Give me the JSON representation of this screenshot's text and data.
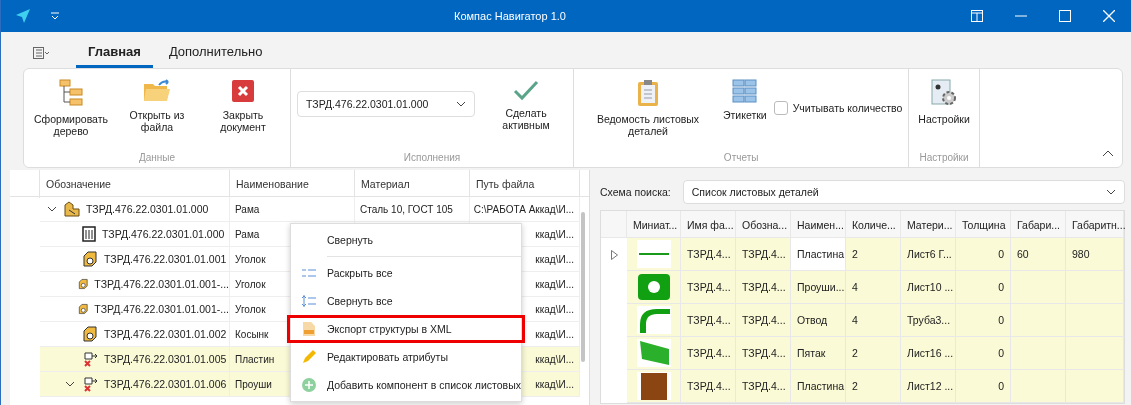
{
  "window": {
    "title": "Компас Навигатор 1.0"
  },
  "tabs": [
    {
      "label": "Главная",
      "selected": true
    },
    {
      "label": "Дополнительно",
      "selected": false
    }
  ],
  "ribbon": {
    "groups": [
      {
        "label": "Данные",
        "buttons": [
          "Сформировать дерево",
          "Открыть из файла",
          "Закрыть документ"
        ]
      },
      {
        "label": "Исполнения",
        "dropdown": "ТЗРД.476.22.0301.01.000",
        "buttons": [
          "Сделать активным"
        ]
      },
      {
        "label": "Отчеты",
        "buttons": [
          "Ведомость листовых деталей",
          "Этикетки"
        ],
        "checkbox": {
          "label": "Учитывать количество",
          "checked": false
        }
      },
      {
        "label": "Настройки",
        "buttons": [
          "Настройки"
        ]
      }
    ]
  },
  "tree": {
    "columns": [
      "Обозначение",
      "Наименование",
      "Материал",
      "Путь файла"
    ],
    "rows": [
      {
        "kind": "assembly",
        "designation": "ТЗРД.476.22.0301.01.000",
        "name": "Рама",
        "material": "Сталь 10, ГОСТ 105",
        "path": "С:\\РАБОТА Аккад\\И...",
        "expanded": true,
        "highlighted": false,
        "children": [
          {
            "kind": "drawing",
            "designation": "ТЗРД.476.22.0301.01.000",
            "name": "Рама",
            "path": "ккад\\И...",
            "highlighted": false
          },
          {
            "kind": "part",
            "designation": "ТЗРД.476.22.0301.01.001",
            "name": "Уголок",
            "path": "ккад\\И...",
            "highlighted": false
          },
          {
            "kind": "part",
            "designation": "ТЗРД.476.22.0301.01.001-...",
            "name": "Уголок",
            "path": "ккад\\И...",
            "highlighted": false
          },
          {
            "kind": "part",
            "designation": "ТЗРД.476.22.0301.01.001-...",
            "name": "Уголок",
            "path": "ккад\\И...",
            "highlighted": false
          },
          {
            "kind": "part",
            "designation": "ТЗРД.476.22.0301.01.002",
            "name": "Косынк",
            "path": "ккад\\И...",
            "highlighted": false
          },
          {
            "kind": "sheet",
            "designation": "ТЗРД.476.22.0301.01.005",
            "name": "Пластин",
            "path": "ккад\\И...",
            "highlighted": true
          },
          {
            "kind": "sheet",
            "designation": "ТЗРД.476.22.0301.01.006",
            "name": "Проуши",
            "path": "ккад\\И...",
            "highlighted": true,
            "expanded": true
          }
        ]
      }
    ]
  },
  "context_menu": {
    "items": [
      {
        "label": "Свернуть",
        "highlighted": false
      },
      {
        "label": "Раскрыть все",
        "highlighted": false
      },
      {
        "label": "Свернуть все",
        "highlighted": false
      },
      {
        "label": "Экспорт структуры в XML",
        "highlighted": true
      },
      {
        "label": "Редактировать атрибуты",
        "highlighted": false
      },
      {
        "label": "Добавить компонент в список листовых",
        "highlighted": false
      }
    ]
  },
  "search": {
    "label": "Схема поиска:",
    "value": "Список листовых деталей"
  },
  "parts_table": {
    "columns": [
      "Миниат...",
      "Имя фа...",
      "Обозна...",
      "Наимен...",
      "Количе...",
      "Матери...",
      "Толщина",
      "Габари...",
      "Габаритн..."
    ],
    "rows": [
      {
        "kind": "strip",
        "selected": true,
        "cells": [
          "",
          "ТЗРД.4...",
          "ТЗРД.4...",
          "Пластина",
          "2",
          "Лист6 Г...",
          "0",
          "60",
          "980"
        ]
      },
      {
        "kind": "lug",
        "selected": false,
        "cells": [
          "",
          "ТЗРД.4...",
          "ТЗРД.4...",
          "Проуши...",
          "4",
          "Лист10 ...",
          "0",
          "",
          ""
        ]
      },
      {
        "kind": "bend",
        "selected": false,
        "cells": [
          "",
          "ТЗРД.4...",
          "ТЗРД.4...",
          "Отвод",
          "4",
          "Труба3...",
          "0",
          "",
          ""
        ]
      },
      {
        "kind": "tilted",
        "selected": false,
        "cells": [
          "",
          "ТЗРД.4...",
          "ТЗРД.4...",
          "Пятак",
          "2",
          "Лист16 ...",
          "0",
          "",
          ""
        ]
      },
      {
        "kind": "brown",
        "selected": false,
        "cells": [
          "",
          "ТЗРД.4...",
          "ТЗРД.4...",
          "Пластина",
          "2",
          "Лист12 ...",
          "0",
          "",
          ""
        ]
      }
    ]
  }
}
